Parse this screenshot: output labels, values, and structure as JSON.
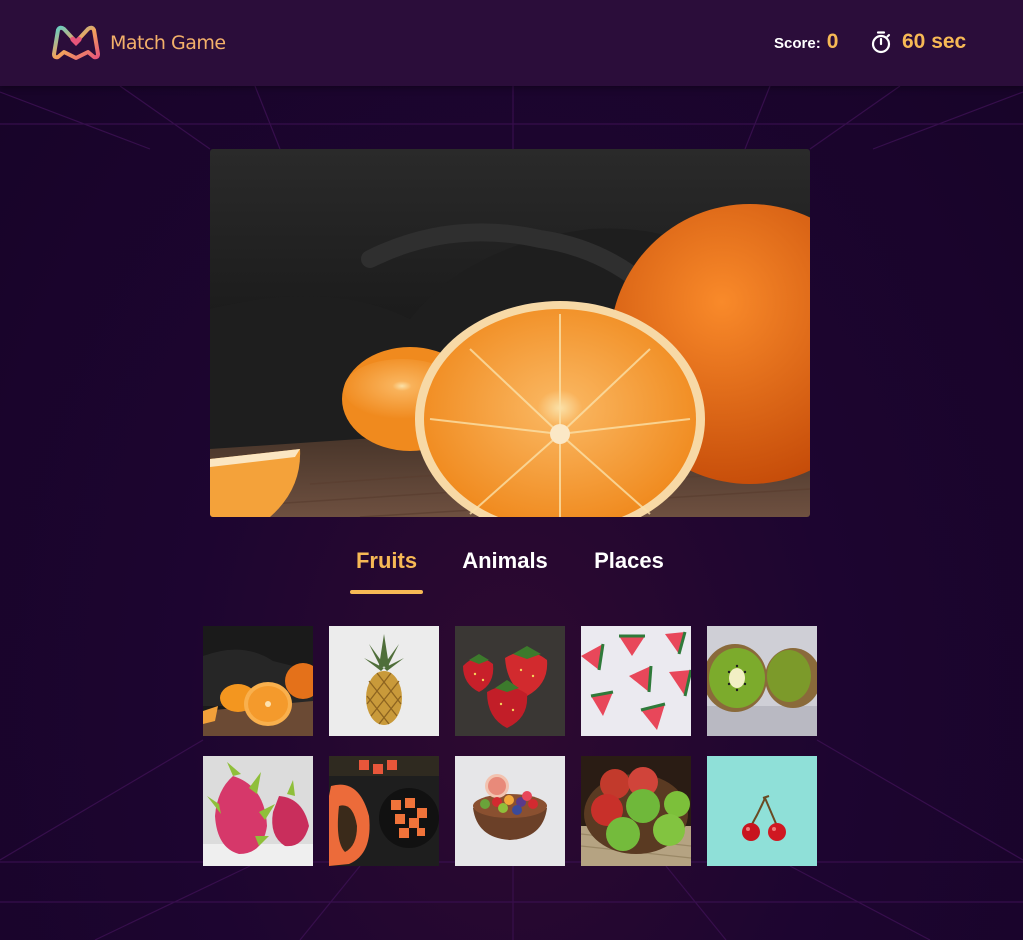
{
  "header": {
    "app_title": "Match Game",
    "score_label": "Score:",
    "score_value": "0",
    "timer_value": "60 sec"
  },
  "main_image": {
    "subject": "orange"
  },
  "tabs": [
    {
      "label": "Fruits",
      "active": true
    },
    {
      "label": "Animals",
      "active": false
    },
    {
      "label": "Places",
      "active": false
    }
  ],
  "thumbnails": [
    {
      "subject": "orange"
    },
    {
      "subject": "pineapple"
    },
    {
      "subject": "strawberry"
    },
    {
      "subject": "watermelon"
    },
    {
      "subject": "kiwi"
    },
    {
      "subject": "dragon-fruit"
    },
    {
      "subject": "papaya"
    },
    {
      "subject": "fruit-bowl"
    },
    {
      "subject": "apple"
    },
    {
      "subject": "cherry"
    }
  ],
  "colors": {
    "accent": "#f7b955",
    "header_bg": "#2b0d3a",
    "page_bg": "#1c0630",
    "text": "#ffffff"
  },
  "icons": {
    "logo": "match-game-logo-icon",
    "timer": "stopwatch-icon"
  }
}
